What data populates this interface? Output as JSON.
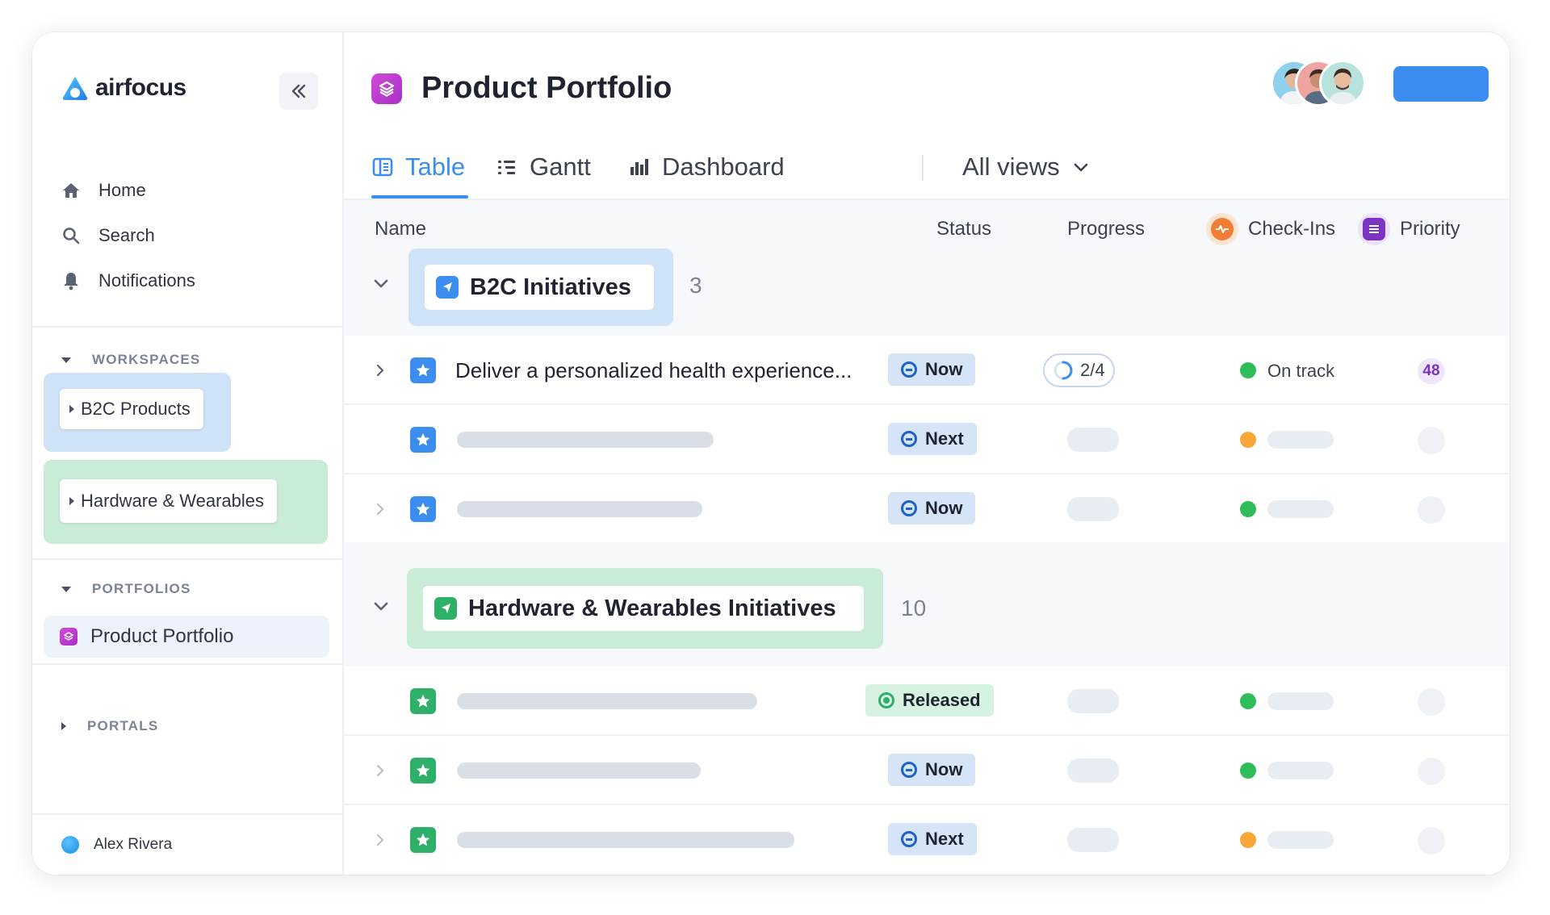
{
  "app": {
    "logo_text": "airfocus"
  },
  "sidebar": {
    "nav": [
      {
        "label": "Home",
        "icon": "home-icon"
      },
      {
        "label": "Search",
        "icon": "search-icon"
      },
      {
        "label": "Notifications",
        "icon": "bell-icon"
      }
    ],
    "workspaces_label": "WORKSPACES",
    "workspaces": [
      {
        "label": "B2C Products",
        "color": "#cfe3f8"
      },
      {
        "label": "Hardware & Wearables",
        "color": "#c9ecd6"
      }
    ],
    "portfolios_label": "PORTFOLIOS",
    "portfolio_item": "Product Portfolio",
    "portals_label": "PORTALS",
    "user_name": "Alex Rivera"
  },
  "header": {
    "title": "Product Portfolio",
    "tabs": [
      {
        "label": "Table",
        "icon": "table-icon",
        "active": true
      },
      {
        "label": "Gantt",
        "icon": "gantt-icon",
        "active": false
      },
      {
        "label": "Dashboard",
        "icon": "bar-chart-icon",
        "active": false
      }
    ],
    "all_views": "All views"
  },
  "table": {
    "columns": {
      "name": "Name",
      "status": "Status",
      "progress": "Progress",
      "checkins": "Check-Ins",
      "priority": "Priority"
    },
    "groups": [
      {
        "title": "B2C Initiatives",
        "count": "3",
        "accent": "#3b8ef0",
        "rows": [
          {
            "name": "Deliver a personalized health experience...",
            "status": "Now",
            "progress": "2/4",
            "checkin": "On track",
            "checkin_color": "green",
            "priority": "48"
          },
          {
            "status": "Next",
            "checkin_color": "orange"
          },
          {
            "status": "Now",
            "checkin_color": "green"
          }
        ]
      },
      {
        "title": "Hardware & Wearables Initiatives",
        "count": "10",
        "accent": "#2fb069",
        "rows": [
          {
            "status": "Released",
            "checkin_color": "green"
          },
          {
            "status": "Now",
            "checkin_color": "green"
          },
          {
            "status": "Next",
            "checkin_color": "orange"
          }
        ]
      }
    ]
  }
}
